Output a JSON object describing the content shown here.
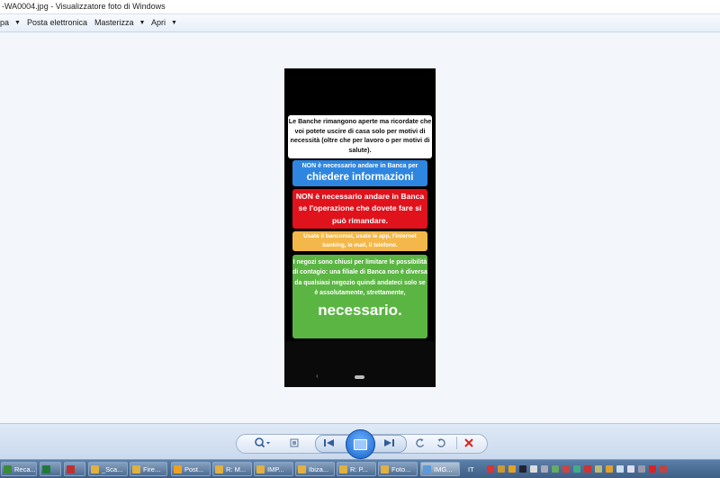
{
  "window": {
    "title": "-WA0004.jpg - Visualizzatore foto di Windows"
  },
  "menu": [
    {
      "label": "pa",
      "has_caret": true
    },
    {
      "label": "Posta elettronica",
      "has_caret": false
    },
    {
      "label": "Masterizza",
      "has_caret": true
    },
    {
      "label": "Apri",
      "has_caret": true
    }
  ],
  "image_content": {
    "white_card": "Le Banche rimangono aperte ma ricordate che voi potete uscire di casa solo per motivi di necessità (oltre che per lavoro o per motivi di salute).",
    "blue_card_small": "NON è necessario andare in Banca per",
    "blue_card_big": "chiedere informazioni",
    "red_card": "NON è necessario andare in Banca se l'operazione che dovete fare si può rimandare.",
    "yellow_card": "Usate il bancomat, usate le app, l'internet banking, le mail, il telefono.",
    "green_card": "I negozi sono chiusi per limitare le possibilità di contagio: una filiale di Banca non è diversa da qualsiasi negozio quindi andateci solo se è assolutamente, strettamente,",
    "green_card_big": "necessario.",
    "nav_back": "‹"
  },
  "colors": {
    "blue": "#2f86e0",
    "red": "#e0121c",
    "yellow": "#f4b84a",
    "green": "#5bb543"
  },
  "controls": {
    "zoom_icon": "magnifier-icon",
    "fit_icon": "actual-size-icon",
    "prev_icon": "previous-icon",
    "slideshow_icon": "slideshow-icon",
    "next_icon": "next-icon",
    "rotate_ccw_icon": "rotate-left-icon",
    "rotate_cw_icon": "rotate-right-icon",
    "delete_icon": "delete-icon"
  },
  "taskbar": {
    "tasks": [
      {
        "label": "Reca...",
        "color": "#3a8a3a"
      },
      {
        "label": "",
        "color": "#1f7a3a"
      },
      {
        "label": "",
        "color": "#c03030"
      },
      {
        "label": "_Sca...",
        "color": "#e0b040"
      },
      {
        "label": "Fire...",
        "color": "#e0b040"
      },
      {
        "label": "Post...",
        "color": "#f0a020"
      },
      {
        "label": "R: M...",
        "color": "#e0b040"
      },
      {
        "label": "IMP...",
        "color": "#e0b040"
      },
      {
        "label": "Ibiza...",
        "color": "#e0b040"
      },
      {
        "label": "R: P...",
        "color": "#e0b040"
      },
      {
        "label": "Foto...",
        "color": "#e0b040"
      },
      {
        "label": "IMG...",
        "color": "#5a9ad8"
      }
    ],
    "language": "IT"
  }
}
